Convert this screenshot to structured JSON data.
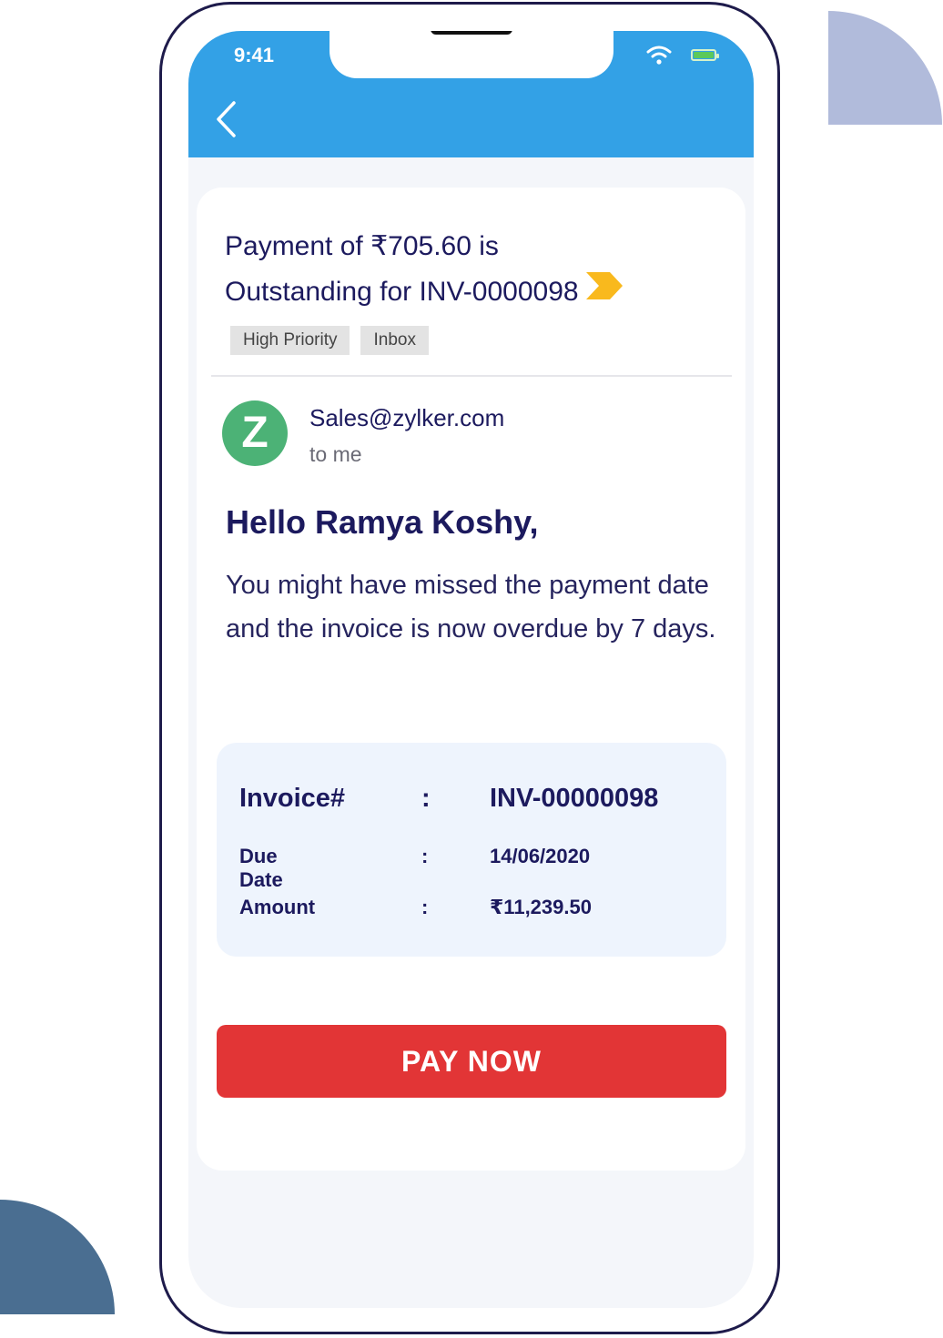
{
  "status_bar": {
    "time": "9:41"
  },
  "email": {
    "subject_line1": "Payment  of ₹705.60 is",
    "subject_line2": "Outstanding for INV-0000098",
    "tags": [
      "High Priority",
      "Inbox"
    ],
    "sender": "Sales@zylker.com",
    "recipient": "to me",
    "avatar_letter": "Z",
    "greeting": "Hello Ramya Koshy,",
    "body": "You might have  missed the payment date and the invoice is now overdue by 7 days."
  },
  "invoice": {
    "rows": [
      {
        "label": "Invoice#",
        "sep": ":",
        "value": "INV-00000098"
      },
      {
        "label": "Due Date",
        "sep": ":",
        "value": "14/06/2020"
      },
      {
        "label": "Amount",
        "sep": ":",
        "value": "₹11,239.50"
      }
    ]
  },
  "actions": {
    "pay_label": "PAY NOW"
  },
  "colors": {
    "header": "#33a1e6",
    "pay_button": "#e23536",
    "text": "#1c1a5e",
    "avatar": "#4cb276",
    "importance_marker": "#f9b91d"
  },
  "icons": {
    "back": "chevron-left-icon",
    "wifi": "wifi-icon",
    "battery": "battery-icon",
    "importance": "importance-marker-icon"
  }
}
